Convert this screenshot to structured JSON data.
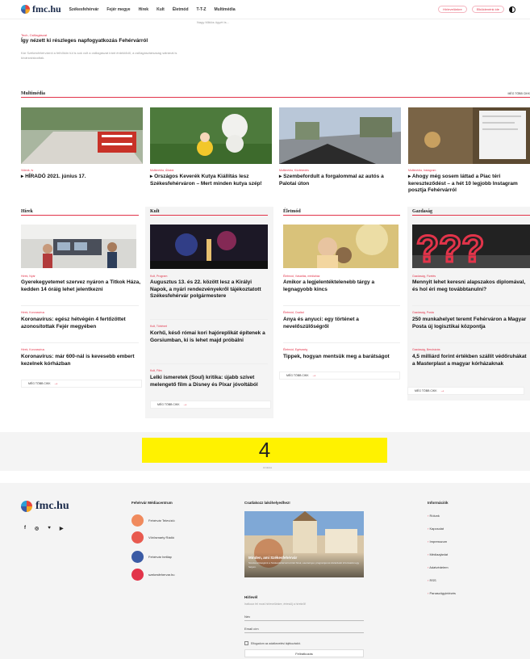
{
  "header": {
    "logo_text": "fmc.hu",
    "nav": [
      "Székesfehérvár",
      "Fejér megye",
      "Hírek",
      "Kult",
      "Életmód",
      "T-T-Z",
      "Multimédia"
    ],
    "buttons": [
      "Hírlevelünkre",
      "Elküldenénk ide"
    ],
    "theme_icon": "contrast-icon"
  },
  "top_note": "Nagy Miklós ügyét is...",
  "lead": {
    "meta": "Tech, Csillagászat",
    "title": "Így nézett ki részleges napfogyatkozás Fehérvárról",
    "text": "Kár Székesfehérvárról a felhőkön túl is sok volt a csillagászat iránt érdeklődő, a csillagásztársaság sátránál is kíváncsiskodtak."
  },
  "multimedia": {
    "title": "Multimédia",
    "more": "MÉG TÖBB CIKK",
    "items": [
      {
        "meta": "Videók, tv",
        "title": "HÍRADÓ 2021. június 17."
      },
      {
        "meta": "Multimédia, Állatok",
        "title": "Országos Keverék Kutya Kiállítás lesz Székesfehérváron – Mert minden kutya szép!"
      },
      {
        "meta": "Multimédia, Közlekedés",
        "title": "Szembefordult a forgalommal az autós a Palotai úton"
      },
      {
        "meta": "Multimédia, Instagram",
        "title": "Ahogy még sosem láttad a Piac téri kereszteződést – a hét 10 legjobb Instagram posztja Fehérvárról"
      }
    ]
  },
  "hirek": {
    "title": "Hírek",
    "more": "MÉG TÖBB CIKK",
    "items": [
      {
        "meta": "Hírek, Nyár",
        "title": "Gyerekegyetemet szervez nyáron a Titkok Háza, kedden 14 óráig lehet jelentkezni"
      },
      {
        "meta": "Hírek, Koronavírus",
        "title": "Koronavírus: egész hétvégén 4 fertőzöttet azonosítottak Fejér megyében"
      },
      {
        "meta": "Hírek, Koronavírus",
        "title": "Koronavírus: már 600-nál is kevesebb embert kezelnek kórházban"
      }
    ]
  },
  "kult": {
    "title": "Kult",
    "more": "MÉG TÖBB CIKK",
    "items": [
      {
        "meta": "Kult, Program",
        "title": "Augusztus 13. és 22. között lesz a Királyi Napok, a nyári rendezvényekről tájékoztatott Székesfehérvár polgármestere"
      },
      {
        "meta": "Kult, Történet",
        "title": "Korhű, késő római kori hajóreplikát építenek a Gorsiumban, ki is lehet majd próbálni"
      },
      {
        "meta": "Kult, Film",
        "title": "Lelki ismeretek (Soul) kritika: újabb szívet melengető film a Disney és Pixar jóvoltából"
      }
    ]
  },
  "eletmod": {
    "title": "Életmód",
    "more": "MÉG TÖBB CIKK",
    "items": [
      {
        "meta": "Életmód, Vásárlás, médiaház",
        "title": "Amikor a legjelentéktelenebb tárgy a legnagyobb kincs"
      },
      {
        "meta": "Életmód, Család",
        "title": "Anya és anyuci: egy történet a nevelőszülőségről"
      },
      {
        "meta": "Életmód, Egészség",
        "title": "Tippek, hogyan mentsük meg a barátságot"
      }
    ]
  },
  "gazdasag": {
    "title": "Gazdaság",
    "more": "MÉG TÖBB CIKK",
    "items": [
      {
        "meta": "Gazdaság, Fizetés",
        "title": "Mennyit lehet keresni alapszakos diplomával, és hol éri meg továbbtanulni?"
      },
      {
        "meta": "Gazdaság, Posta",
        "title": "250 munkahelyet teremt Fehérváron a Magyar Posta új logisztikai központja"
      },
      {
        "meta": "Gazdaság, Beruházás",
        "title": "4,5 milliárd forint értékben szállít védőruhákat a Masterplast a magyar kórházaknak"
      }
    ]
  },
  "ad": {
    "number": "4",
    "label": "Hirdetés"
  },
  "footer": {
    "logo_text": "fmc.hu",
    "social": [
      "f",
      "◎",
      "♥",
      "▶"
    ],
    "media_head": "Fehérvár Médiacentrum",
    "brands": [
      "Fehérvár Televízió",
      "Vörösmarty Rádió",
      "Fehérvár hetilap",
      "szekesfehervar.hu"
    ],
    "brand_colors": [
      "#f08a5d",
      "#e85a4f",
      "#3b5ba5",
      "#e2344a"
    ],
    "feature_head": "Csatlakozz lakóhelyedhez!",
    "feature_title": "Minden, ami Székesfehérvár",
    "feature_text": "Szerkesztőségünk a Székesfehérvárt érintő hírek, eseményei, programjai és közérdekű információi egy helyen.",
    "newsletter_head": "Hírlevél",
    "newsletter_text": "Iratkozz fel most hírlevelünkre, értesülj a hírekről!",
    "name_label": "Név",
    "email_label": "Email cím",
    "consent": "Elfogadom az adatkezelési tájékoztatót.",
    "submit": "Feliratkozás",
    "info_head": "Információk",
    "info": [
      "Rólunk",
      "Kapcsolat",
      "Impresszum",
      "Médiaajánlat",
      "Adatvédelem",
      "RSS",
      "Panaszügyintézés"
    ]
  }
}
